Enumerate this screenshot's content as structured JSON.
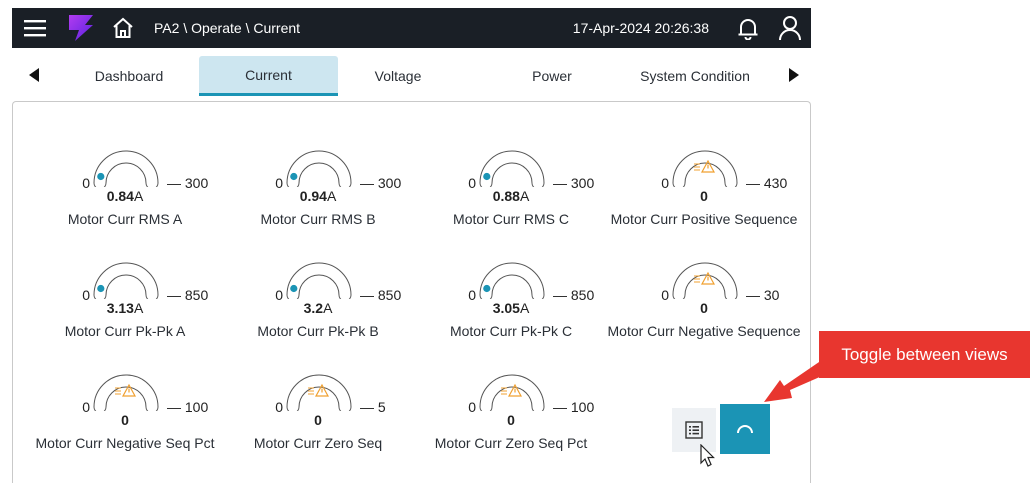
{
  "header": {
    "breadcrumb": "PA2 \\ Operate \\ Current",
    "datetime": "17-Apr-2024 20:26:38",
    "brand_color": "#7b2ff7"
  },
  "tabs": [
    {
      "label": "Dashboard",
      "active": false
    },
    {
      "label": "Current",
      "active": true
    },
    {
      "label": "Voltage",
      "active": false
    },
    {
      "label": "Power",
      "active": false
    },
    {
      "label": "System Condition",
      "active": false
    }
  ],
  "gauges": [
    {
      "name": "Motor Curr RMS A",
      "min": "0",
      "max": "300",
      "value": "0.84",
      "unit": "A",
      "level": 0.0028,
      "status": "ok"
    },
    {
      "name": "Motor Curr RMS B",
      "min": "0",
      "max": "300",
      "value": "0.94",
      "unit": "A",
      "level": 0.0031,
      "status": "ok"
    },
    {
      "name": "Motor Curr RMS C",
      "min": "0",
      "max": "300",
      "value": "0.88",
      "unit": "A",
      "level": 0.0029,
      "status": "ok"
    },
    {
      "name": "Motor Curr Positive Sequence",
      "min": "0",
      "max": "430",
      "value": "0",
      "unit": "",
      "level": 0,
      "status": "warning"
    },
    {
      "name": "Motor Curr Pk-Pk A",
      "min": "0",
      "max": "850",
      "value": "3.13",
      "unit": "A",
      "level": 0.0037,
      "status": "ok"
    },
    {
      "name": "Motor Curr Pk-Pk B",
      "min": "0",
      "max": "850",
      "value": "3.2",
      "unit": "A",
      "level": 0.0038,
      "status": "ok"
    },
    {
      "name": "Motor Curr Pk-Pk C",
      "min": "0",
      "max": "850",
      "value": "3.05",
      "unit": "A",
      "level": 0.0036,
      "status": "ok"
    },
    {
      "name": "Motor Curr Negative Sequence",
      "min": "0",
      "max": "30",
      "value": "0",
      "unit": "",
      "level": 0,
      "status": "warning"
    },
    {
      "name": "Motor Curr Negative Seq Pct",
      "min": "0",
      "max": "100",
      "value": "0",
      "unit": "",
      "level": 0,
      "status": "warning"
    },
    {
      "name": "Motor Curr Zero Seq",
      "min": "0",
      "max": "5",
      "value": "0",
      "unit": "",
      "level": 0,
      "status": "warning"
    },
    {
      "name": "Motor Curr Zero Seq Pct",
      "min": "0",
      "max": "100",
      "value": "0",
      "unit": "",
      "level": 0,
      "status": "warning"
    }
  ],
  "view_toggle": {
    "list_icon": "list-icon",
    "gauge_icon": "gauge-icon",
    "active": "gauge",
    "accent": "#1b94b5"
  },
  "annotation": {
    "callout_text": "Toggle between views",
    "color": "#e8362f"
  },
  "colors": {
    "indicator": "#1b94b5",
    "warning": "#f0a030",
    "topbar": "#1a1f26"
  }
}
